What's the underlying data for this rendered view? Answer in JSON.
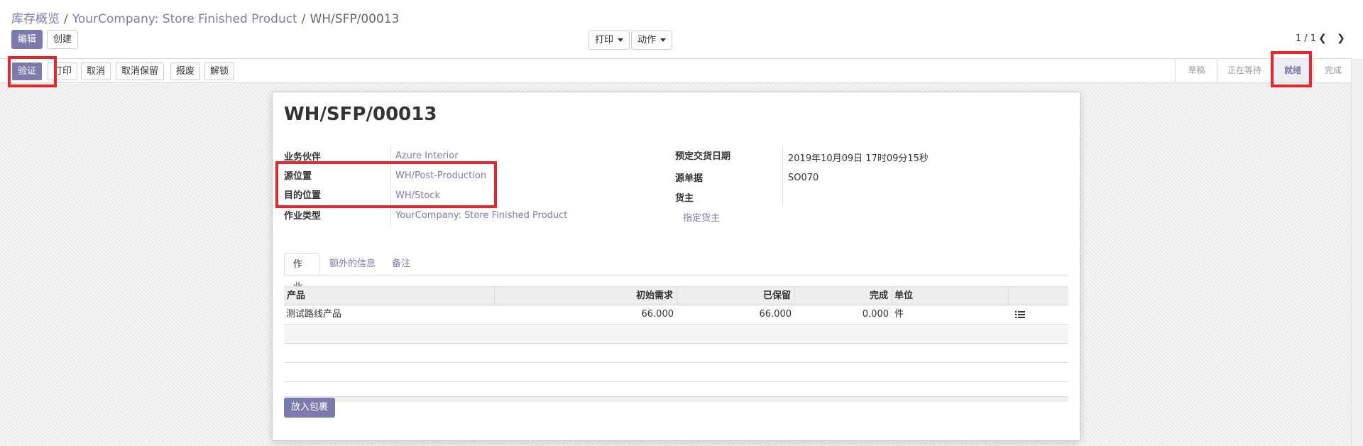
{
  "breadcrumb": {
    "root": "库存概览",
    "parent": "YourCompany: Store Finished Product",
    "current": "WH/SFP/00013",
    "separator": "/"
  },
  "toolbar": {
    "edit": "编辑",
    "create": "创建",
    "print": "打印",
    "action": "动作",
    "pager": "1 / 1"
  },
  "status_buttons": {
    "validate": "验证",
    "print": "打印",
    "cancel": "取消",
    "unreserve": "取消保留",
    "scrap": "报废",
    "unlock": "解锁"
  },
  "stages": [
    "草稿",
    "正在等待",
    "就绪",
    "完成"
  ],
  "active_stage": "就绪",
  "record": {
    "title": "WH/SFP/00013",
    "partner_label": "业务伙伴",
    "partner": "Azure Interior",
    "source_location_label": "源位置",
    "source_location": "WH/Post-Production",
    "dest_location_label": "目的位置",
    "dest_location": "WH/Stock",
    "operation_type_label": "作业类型",
    "operation_type": "YourCompany: Store Finished Product",
    "scheduled_date_label": "预定交货日期",
    "scheduled_date": "2019年10月09日 17时09分15秒",
    "origin_label": "源单据",
    "origin": "SO070",
    "owner_label": "货主",
    "owner_link": "指定货主"
  },
  "tabs": [
    "作业",
    "额外的信息",
    "备注"
  ],
  "table": {
    "headers": {
      "product": "产品",
      "initial_demand": "初始需求",
      "reserved": "已保留",
      "done": "完成",
      "uom": "单位"
    },
    "rows": [
      {
        "product": "测试路线产品",
        "initial_demand": "66.000",
        "reserved": "66.000",
        "done": "0.000",
        "uom": "件"
      }
    ]
  },
  "put_in_pack": "放入包裹",
  "colors": {
    "accent": "#7c7bad",
    "highlight_box": "#e8262c"
  }
}
